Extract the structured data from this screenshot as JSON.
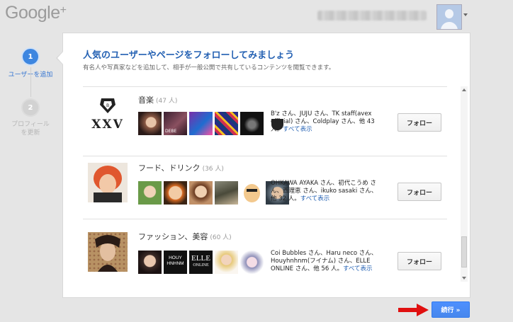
{
  "header": {
    "logo": "Google",
    "logo_plus": "+"
  },
  "steps": [
    {
      "number": "1",
      "label": "ユーザーを追加"
    },
    {
      "number": "2",
      "label": "プロフィールを更新"
    }
  ],
  "panel": {
    "title": "人気のユーザーやページをフォローしてみましょう",
    "subtitle": "有名人や写真家などを追加して、相手が一般公開で共有しているコンテンツを閲覧できます。"
  },
  "categories": [
    {
      "name": "音楽",
      "count": "(47 人)",
      "desc": "B'z さん、JUJU さん、TK staff(avex official) さん、Coldplay さん、他 43 人。",
      "show_all": "すべて表示",
      "follow": "フォロー"
    },
    {
      "name": "フード、ドリンク",
      "count": "(36 人)",
      "desc": "OHKAWA AYAKA さん、初代こうめ さん、西理恵 さん、ikuko sasaki さん、他 32 人。",
      "show_all": "すべて表示",
      "follow": "フォロー"
    },
    {
      "name": "ファッション、美容",
      "count": "(60 人)",
      "desc": "Coi Bubbles さん、Haru neco さん、Houyhnhnm(フイナム) さん、ELLE ONLINE さん、他 56 人。",
      "show_all": "すべて表示",
      "follow": "フォロー"
    }
  ],
  "thumb_text": {
    "xxv": "XXV",
    "debe": "DEBE",
    "houy1": "HOUY",
    "houy2": "HNHNM",
    "elle": "ELLE",
    "online": "ONLINE"
  },
  "continue_label": "続行 »",
  "colors": {
    "accent": "#2461b3",
    "button_blue": "#4d90fe",
    "arrow_red": "#e01010"
  }
}
